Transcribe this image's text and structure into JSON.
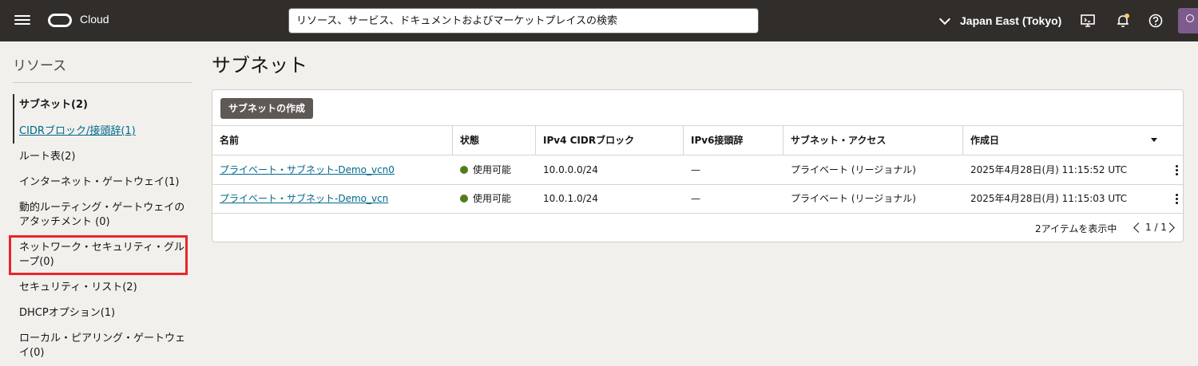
{
  "topbar": {
    "brand": "Cloud",
    "search_placeholder": "リソース、サービス、ドキュメントおよびマーケットプレイスの検索",
    "region": "Japan East (Tokyo)",
    "icons": [
      "menu-icon",
      "oracle-logo",
      "chevron-down-icon",
      "cloud-shell-icon",
      "bell-icon",
      "help-icon",
      "user-icon"
    ]
  },
  "sidebar": {
    "title": "リソース",
    "items": [
      {
        "label": "サブネット(2)"
      },
      {
        "label": "CIDRブロック/接頭辞(1)"
      },
      {
        "label": "ルート表(2)"
      },
      {
        "label": "インターネット・ゲートウェイ(1)"
      },
      {
        "label": "動的ルーティング・ゲートウェイのアタッチメント (0)"
      },
      {
        "label": "ネットワーク・セキュリティ・グループ(0)"
      },
      {
        "label": "セキュリティ・リスト(2)"
      },
      {
        "label": "DHCPオプション(1)"
      },
      {
        "label": "ローカル・ピアリング・ゲートウェイ(0)"
      }
    ]
  },
  "main": {
    "title": "サブネット",
    "create_button": "サブネットの作成",
    "columns": [
      "名前",
      "状態",
      "IPv4 CIDRブロック",
      "IPv6接頭辞",
      "サブネット・アクセス",
      "作成日"
    ],
    "rows": [
      {
        "name": "プライベート・サブネット-Demo_vcn0",
        "status": "使用可能",
        "ipv4": "10.0.0.0/24",
        "ipv6": "—",
        "access": "プライベート (リージョナル)",
        "created": "2025年4月28日(月) 11:15:52 UTC"
      },
      {
        "name": "プライベート・サブネット-Demo_vcn",
        "status": "使用可能",
        "ipv4": "10.0.1.0/24",
        "ipv6": "—",
        "access": "プライベート (リージョナル)",
        "created": "2025年4月28日(月) 11:15:03 UTC"
      }
    ],
    "footer": "2アイテムを表示中",
    "page": "1 / 1"
  },
  "colors": {
    "topbar": "#312d2a",
    "link": "#00688c",
    "status_ok": "#4f7d1c",
    "highlight": "#e8262a"
  }
}
